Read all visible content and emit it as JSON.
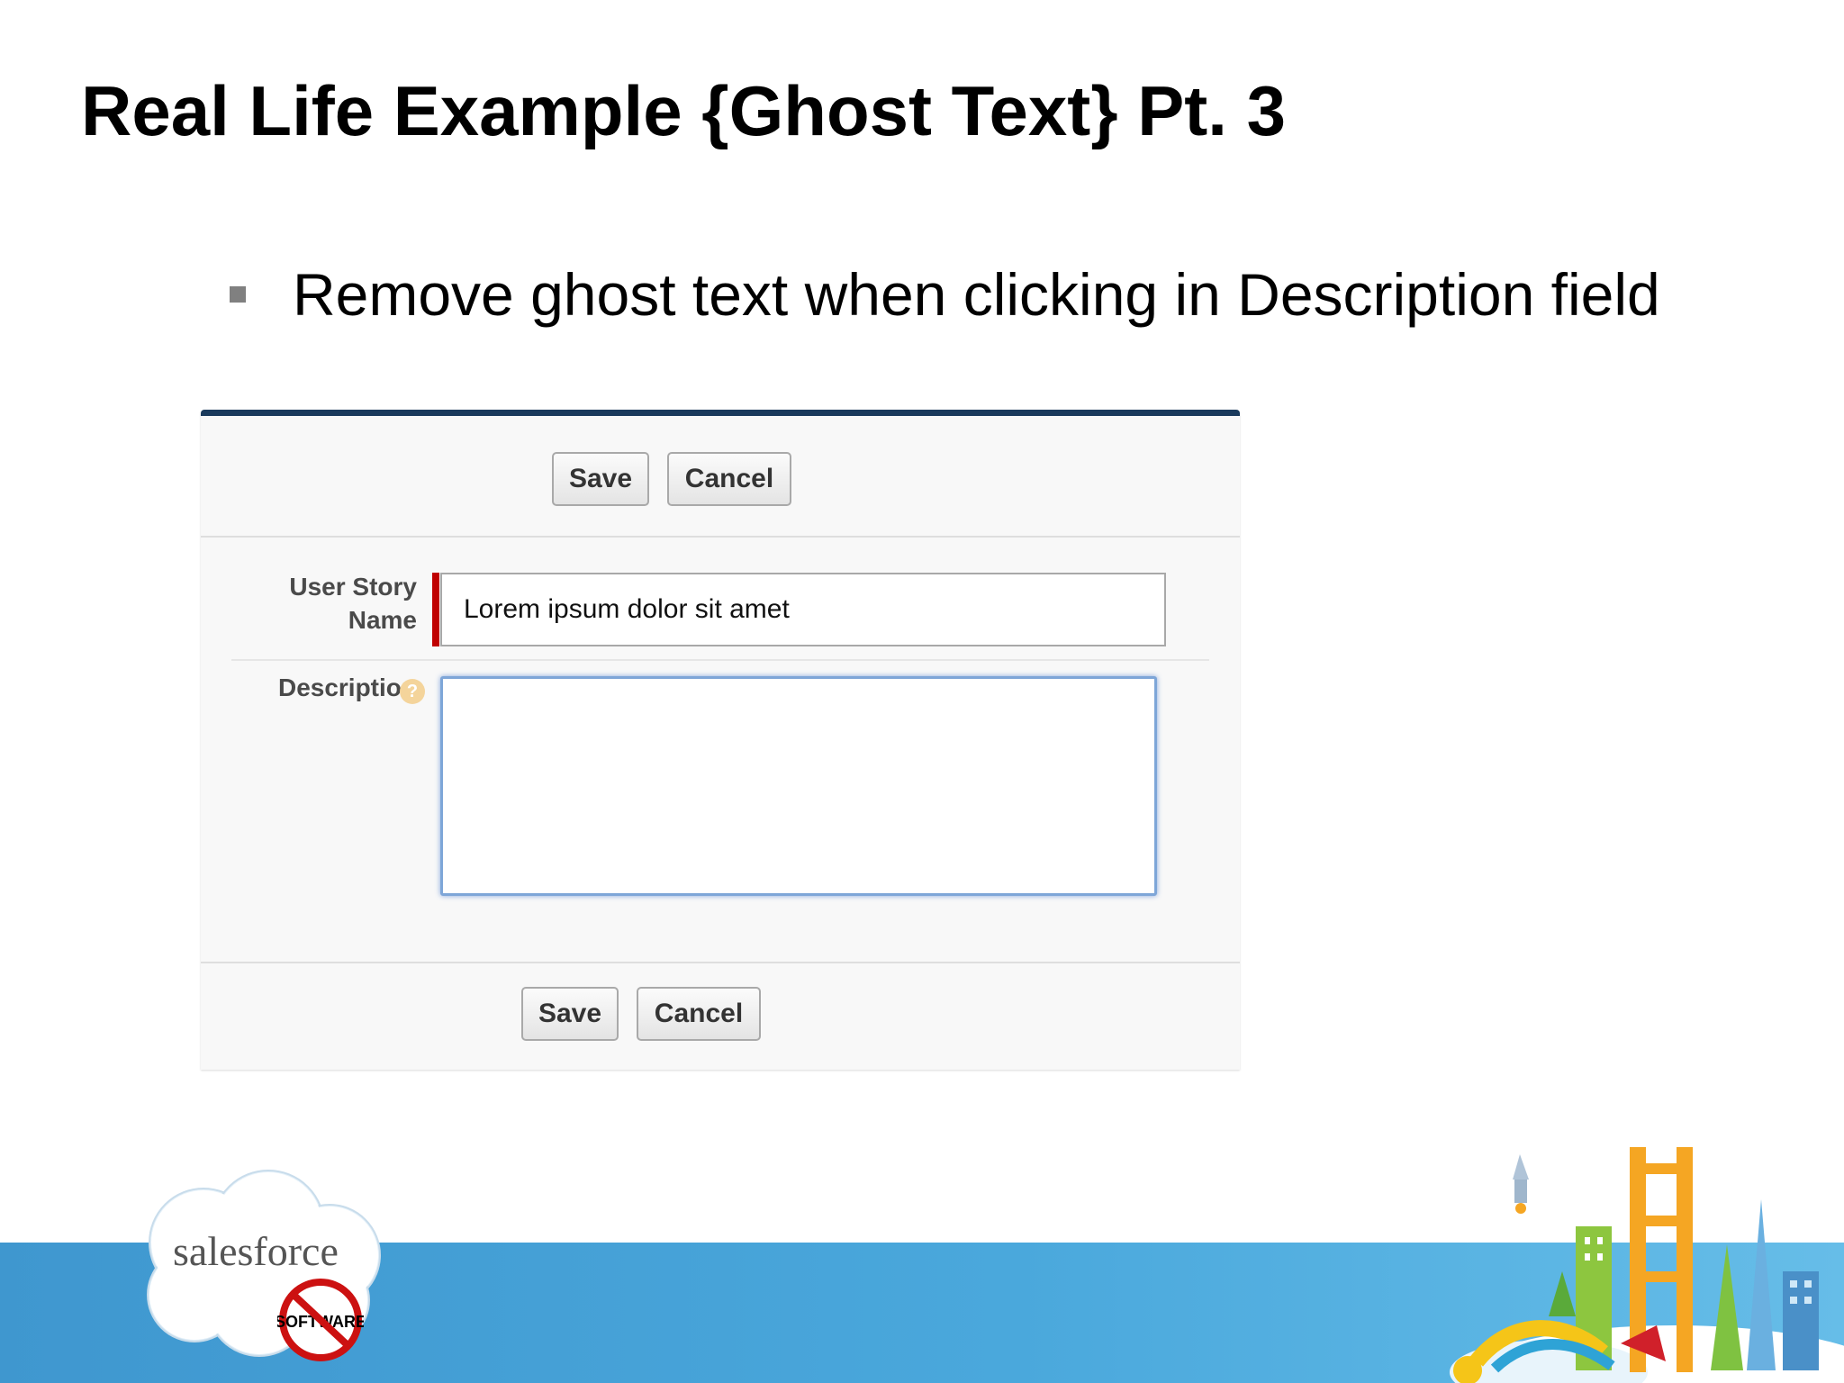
{
  "slide": {
    "title": "Real Life Example {Ghost Text} Pt. 3",
    "bullet": "Remove ghost text when clicking in Description field"
  },
  "form": {
    "top_buttons": {
      "save": "Save",
      "cancel": "Cancel"
    },
    "bottom_buttons": {
      "save": "Save",
      "cancel": "Cancel"
    },
    "user_story_name": {
      "label_line1": "User Story",
      "label_line2": "Name",
      "value": "Lorem ipsum dolor sit amet",
      "required": true
    },
    "description": {
      "label": "Description",
      "value": "",
      "focused": true,
      "help_icon": "?"
    }
  },
  "branding": {
    "logo_text": "salesforce",
    "badge_text": "SOFTWARE"
  },
  "colors": {
    "panel_top_border": "#1a3a5c",
    "required_bar": "#c00000",
    "focus_glow": "#7ea6d8",
    "footer_band": "#4aa8dc"
  },
  "icons": [
    "bullet-square-icon",
    "help-icon",
    "salesforce-cloud-logo",
    "no-software-icon",
    "cityscape-illustration"
  ]
}
